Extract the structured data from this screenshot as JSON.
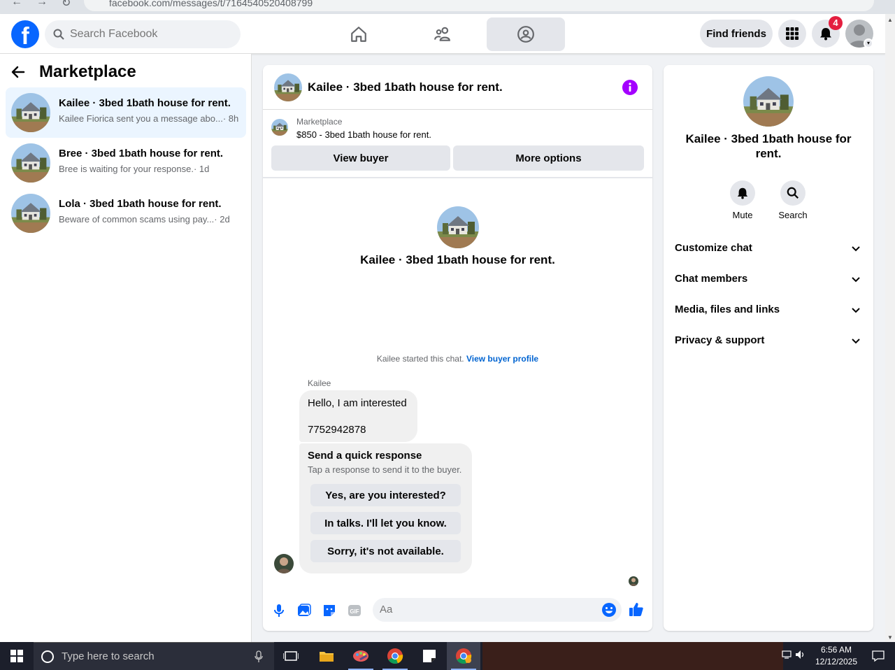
{
  "browser": {
    "url": "facebook.com/messages/t/7164540520408799"
  },
  "topbar": {
    "search_placeholder": "Search Facebook",
    "nav": [
      "home-icon",
      "friends-icon",
      "groups-icon"
    ],
    "find_friends_label": "Find friends",
    "notification_count": "4",
    "brand_color": "#0866ff"
  },
  "sidebar": {
    "title": "Marketplace",
    "conversations": [
      {
        "title": "Kailee · 3bed 1bath house for rent.",
        "preview": "Kailee Fiorica sent you a message abo...",
        "time": "· 8h"
      },
      {
        "title": "Bree · 3bed 1bath house for rent.",
        "preview": "Bree is waiting for your response.",
        "time": "· 1d"
      },
      {
        "title": "Lola · 3bed 1bath house for rent.",
        "preview": "Beware of common scams using pay...",
        "time": "· 2d"
      }
    ]
  },
  "chat": {
    "title": "Kailee · 3bed 1bath house for rent.",
    "listing_label": "Marketplace",
    "listing_price": "$850 - 3bed 1bath house for rent.",
    "view_buyer_label": "View buyer",
    "more_options_label": "More options",
    "center_title": "Kailee · 3bed 1bath house for rent.",
    "started_text": "Kailee started this chat.",
    "buyer_profile_link": "View buyer profile",
    "sender_name": "Kailee",
    "message_line1": "Hello, I am interested",
    "message_line2": "7752942878",
    "quick_title": "Send a quick response",
    "quick_subtitle": "Tap a response to send it to the buyer.",
    "quick_responses": [
      "Yes, are you interested?",
      "In talks. I'll let you know.",
      "Sorry, it's not available."
    ],
    "input_placeholder": "Aa"
  },
  "details": {
    "title": "Kailee · 3bed 1bath house for rent.",
    "mute_label": "Mute",
    "search_label": "Search",
    "sections": [
      "Customize chat",
      "Chat members",
      "Media, files and links",
      "Privacy & support"
    ]
  },
  "taskbar": {
    "search_placeholder": "Type here to search",
    "time": "6:56 AM",
    "date": "12/12/2025"
  }
}
